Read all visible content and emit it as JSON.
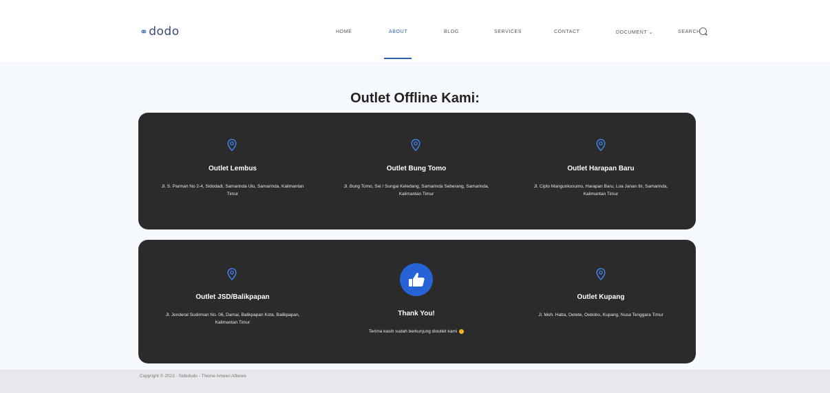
{
  "header": {
    "logo_text": "dodo",
    "nav": [
      {
        "label": "HOME",
        "active": false
      },
      {
        "label": "ABOUT",
        "active": true
      },
      {
        "label": "BLOG",
        "active": false
      },
      {
        "label": "SERVICES",
        "active": false
      },
      {
        "label": "CONTACT",
        "active": false
      },
      {
        "label": "DOCUMENT ⌄",
        "active": false
      },
      {
        "label": "SEARCH",
        "active": false
      }
    ]
  },
  "main": {
    "title": "Outlet Offline Kami:",
    "outlets": [
      {
        "name": "Outlet Lembus",
        "address": "Jl. S. Parman No 2-4, Sidodadi, Samarinda Ulu, Samarinda, Kalimantan Timur"
      },
      {
        "name": "Outlet Bung Tomo",
        "address": "Jl. Bung Tomo, Sei / Sungai Keledang, Samarinda Seberang, Samarinda, Kalimantan Timur"
      },
      {
        "name": "Outlet Harapan Baru",
        "address": "Jl. Cipto Mangunkusumo, Harapan Baru, Loa Janan Ilir, Samarinda, Kalimantan Timur"
      },
      {
        "name": "Outlet JSD/Balikpapan",
        "address": "Jl. Jenderal Sudirman No. 06, Damai, Balikpapan Kota, Balikpapan, Kalimantan Timur"
      },
      {
        "name": "Outlet Kupang",
        "address": "Jl. Moh. Hatta, Oetete, Oebobo, Kupang, Nusa Tenggara Timur"
      }
    ],
    "thanks": {
      "title": "Thank You!",
      "message": "Terima kasih sudah berkunjung dioutlet kami"
    }
  },
  "footer": {
    "copyright": "Copyright © 2023 - Sidodudo - Theme Ameen Afbowe"
  },
  "colors": {
    "accent": "#2a5db0",
    "panel": "#2b2b2b",
    "thumb_circle": "#2563d6",
    "pin": "#3f7de0"
  }
}
